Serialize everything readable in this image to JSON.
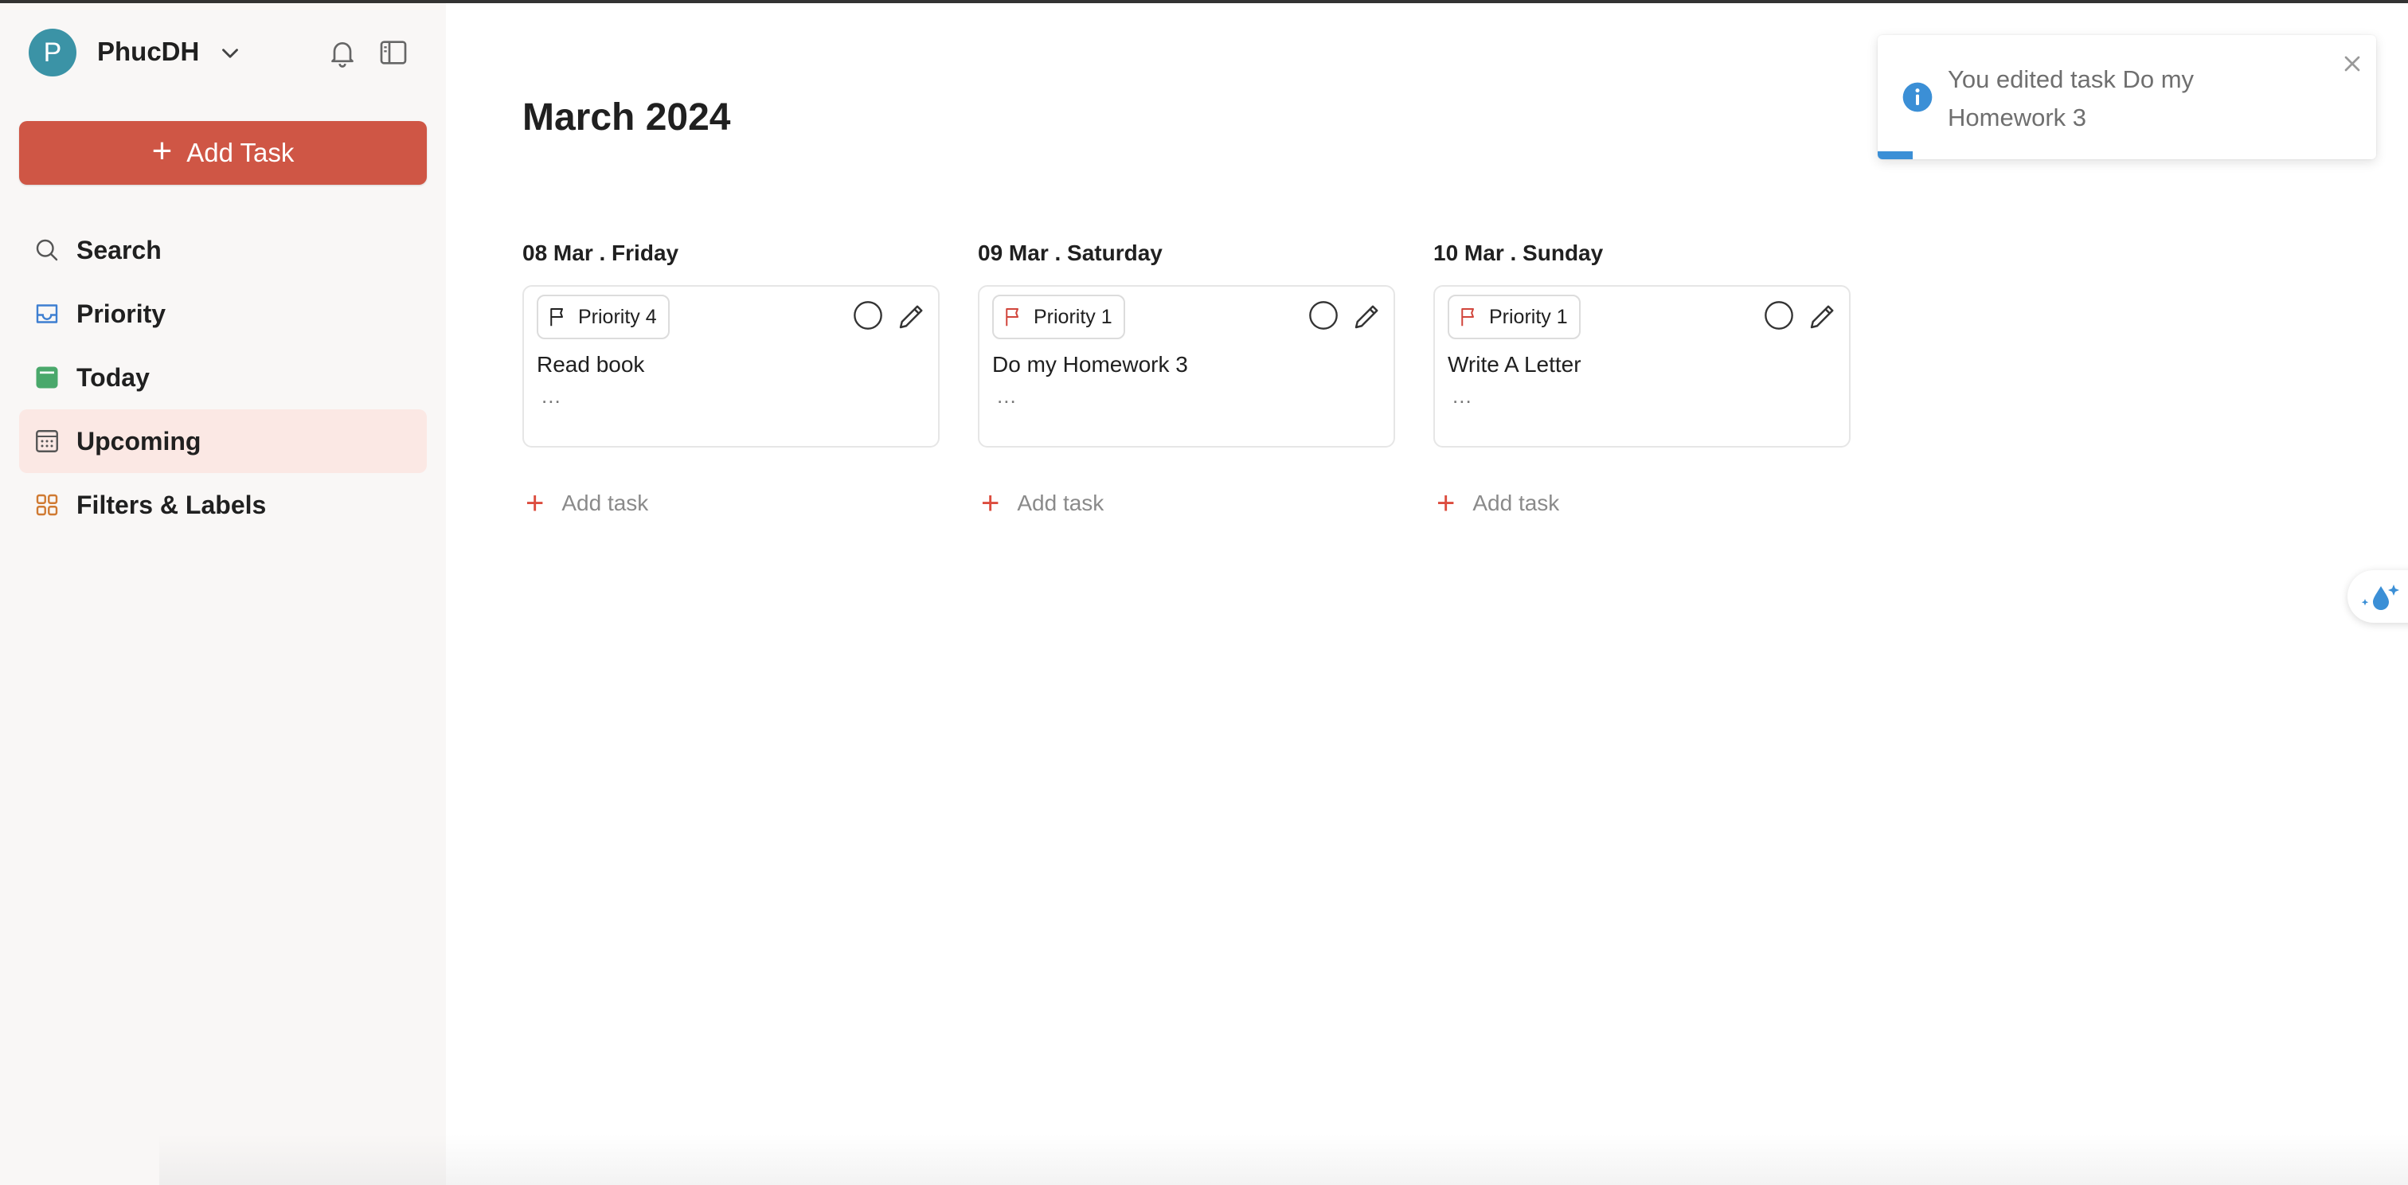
{
  "user": {
    "initial": "P",
    "name": "PhucDH"
  },
  "sidebar": {
    "add_task_label": "Add Task",
    "items": [
      {
        "label": "Search",
        "icon": "search-icon",
        "active": false
      },
      {
        "label": "Priority",
        "icon": "inbox-icon",
        "active": false
      },
      {
        "label": "Today",
        "icon": "calendar-today-icon",
        "active": false
      },
      {
        "label": "Upcoming",
        "icon": "calendar-grid-icon",
        "active": true
      },
      {
        "label": "Filters & Labels",
        "icon": "grid-icon",
        "active": false
      }
    ]
  },
  "main": {
    "title": "March 2024",
    "columns": [
      {
        "date": "08 Mar . Friday",
        "task": {
          "priority": "Priority 4",
          "flag_color": "#202020",
          "name": "Read book",
          "description": "..."
        },
        "add_label": "Add task"
      },
      {
        "date": "09 Mar . Saturday",
        "task": {
          "priority": "Priority 1",
          "flag_color": "#d1453b",
          "name": "Do my Homework 3",
          "description": "..."
        },
        "add_label": "Add task"
      },
      {
        "date": "10 Mar . Sunday",
        "task": {
          "priority": "Priority 1",
          "flag_color": "#d1453b",
          "name": "Write A Letter",
          "description": "..."
        },
        "add_label": "Add task"
      }
    ]
  },
  "toast": {
    "message": "You edited task Do my Homework 3",
    "progress": 0.07
  },
  "colors": {
    "accent": "#cf5645",
    "active_bg": "#fbe8e4",
    "info": "#3b8fd6"
  }
}
